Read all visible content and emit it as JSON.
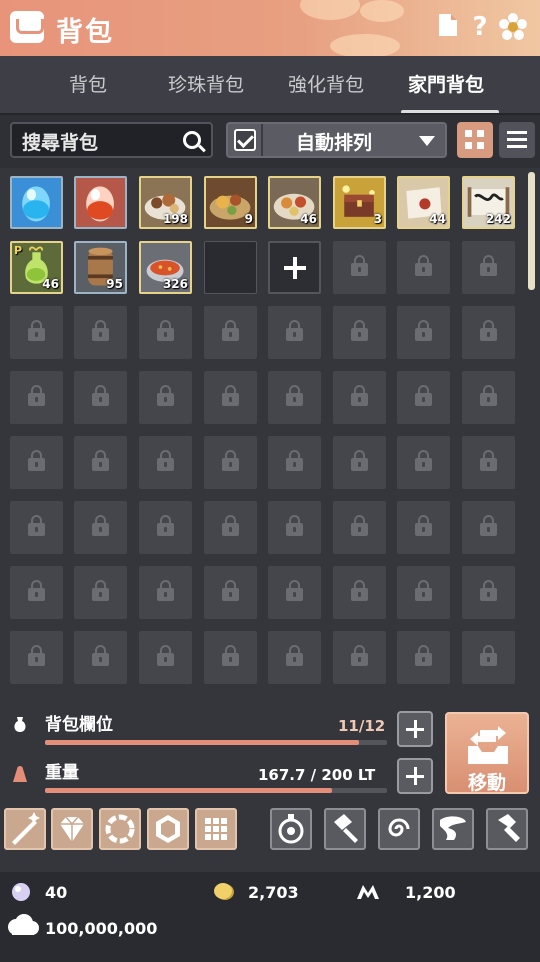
{
  "header": {
    "title": "背包",
    "help_label": "?"
  },
  "tabs": [
    {
      "label": "背包",
      "active": false
    },
    {
      "label": "珍珠背包",
      "active": false
    },
    {
      "label": "強化背包",
      "active": false
    },
    {
      "label": "家門背包",
      "active": true
    }
  ],
  "search": {
    "placeholder": "搜尋背包"
  },
  "sort": {
    "label": "自動排列",
    "checked": true
  },
  "items": [
    {
      "icon": "blue-crystal-egg-icon",
      "qty": ""
    },
    {
      "icon": "red-crystal-egg-icon",
      "qty": ""
    },
    {
      "icon": "food-platter-icon",
      "qty": "198"
    },
    {
      "icon": "feast-platter-icon",
      "qty": "9"
    },
    {
      "icon": "banquet-platter-icon",
      "qty": "46"
    },
    {
      "icon": "treasure-box-icon",
      "qty": "3"
    },
    {
      "icon": "sealed-letter-icon",
      "qty": "44"
    },
    {
      "icon": "scroll-icon",
      "qty": "242"
    },
    {
      "icon": "green-elixir-icon",
      "qty": "46",
      "badge": "P"
    },
    {
      "icon": "wooden-barrel-icon",
      "qty": "95"
    },
    {
      "icon": "stew-bowl-icon",
      "qty": "326"
    }
  ],
  "slots": {
    "label": "背包欄位",
    "value": "11/12",
    "fraction": 0.917
  },
  "weight": {
    "label": "重量",
    "value": "167.7 / 200 LT",
    "fraction": 0.8385
  },
  "move_button": {
    "label": "移動"
  },
  "currencies": {
    "pearl": "40",
    "silver": "2,703",
    "mileage": "1,200",
    "cloud": "100,000,000"
  },
  "colors": {
    "accent": "#e48e7a",
    "header": "#e8947a",
    "value": "#f0c9b4"
  }
}
